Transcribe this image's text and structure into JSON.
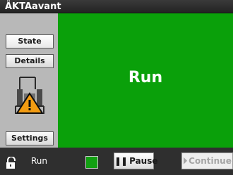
{
  "window": {
    "title": "ÄKTAavant"
  },
  "sidebar": {
    "state_label": "State",
    "details_label": "Details",
    "settings_label": "Settings",
    "status_icon": "system-warning-icon"
  },
  "main": {
    "status_text": "Run"
  },
  "bottom": {
    "run_status": "Run",
    "pause_label": "Pause",
    "continue_label": "Continue",
    "indicator_color": "#12a012"
  },
  "colors": {
    "run_green": "#0aa00a",
    "warning_orange": "#f39c12"
  }
}
